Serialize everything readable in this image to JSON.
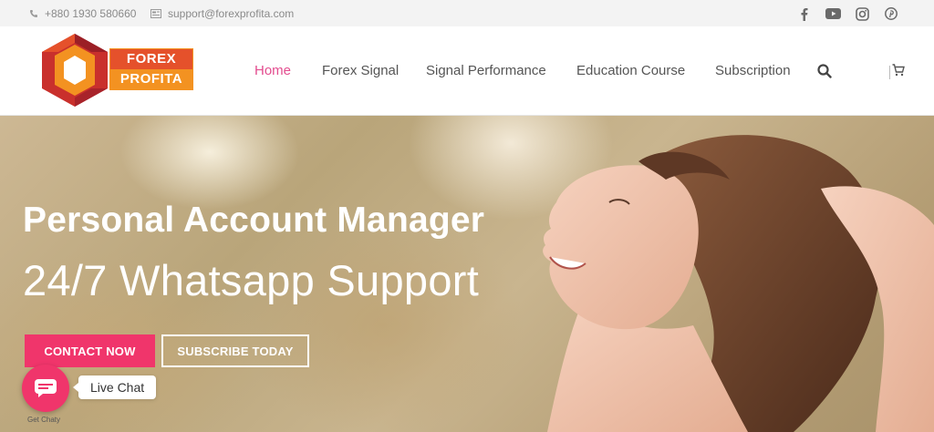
{
  "topbar": {
    "phone": "+880 1930 580660",
    "email": "support@forexprofita.com",
    "social": [
      "facebook-icon",
      "youtube-icon",
      "instagram-icon",
      "pinterest-icon"
    ]
  },
  "logo": {
    "line1": "FOREX",
    "line2": "PROFITA"
  },
  "nav": {
    "items": [
      {
        "label": "Home",
        "active": true
      },
      {
        "label": "Forex Signal"
      },
      {
        "label": "Signal Performance"
      },
      {
        "label": "Education Course"
      },
      {
        "label": "Subscription"
      }
    ],
    "search_icon": "search-icon",
    "cart_icon": "cart-icon"
  },
  "hero": {
    "headline": "Personal Account Manager",
    "subheadline": "24/7 Whatsapp Support",
    "contact_label": "CONTACT NOW",
    "subscribe_label": "SUBSCRIBE TODAY"
  },
  "chat": {
    "bubble": "Live Chat",
    "credit": "Get Chaty"
  },
  "colors": {
    "accent_pink": "#f0356b",
    "nav_active": "#e34d8f",
    "logo_red": "#e5512b",
    "logo_orange": "#f39221"
  }
}
